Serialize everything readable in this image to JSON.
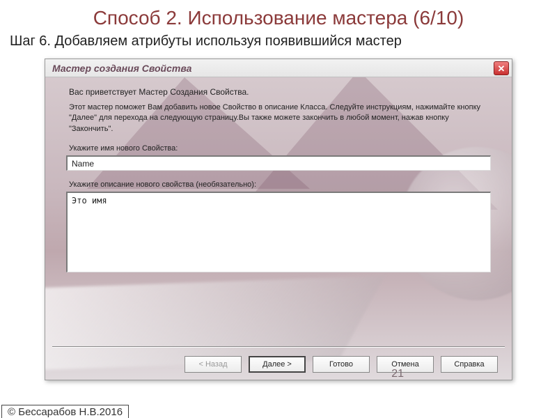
{
  "slide": {
    "title": "Способ 2. Использование мастера (6/10)",
    "step": "Шаг 6. Добавляем атрибуты используя появившийся мастер",
    "pagenum": "21",
    "copyright": "© Бессарабов Н.В.2016"
  },
  "dialog": {
    "title": "Мастер создания Свойства",
    "intro_bold": "Вас приветствует Мастер Создания Свойства.",
    "intro_text": "Этот мастер поможет Вам добавить новое Свойство в описание Класса. Следуйте инструкциям, нажимайте кнопку \"Далее\" для перехода на следующую страницу.Вы также можете закончить в любой момент, нажав кнопку \"Закончить\".",
    "name_label": "Укажите имя нового Свойства:",
    "name_value": "Name",
    "desc_label": "Укажите описание нового свойства (необязательно):",
    "desc_value": "Это имя",
    "buttons": {
      "back": "< Назад",
      "next": "Далее >",
      "finish": "Готово",
      "cancel": "Отмена",
      "help": "Справка"
    }
  }
}
